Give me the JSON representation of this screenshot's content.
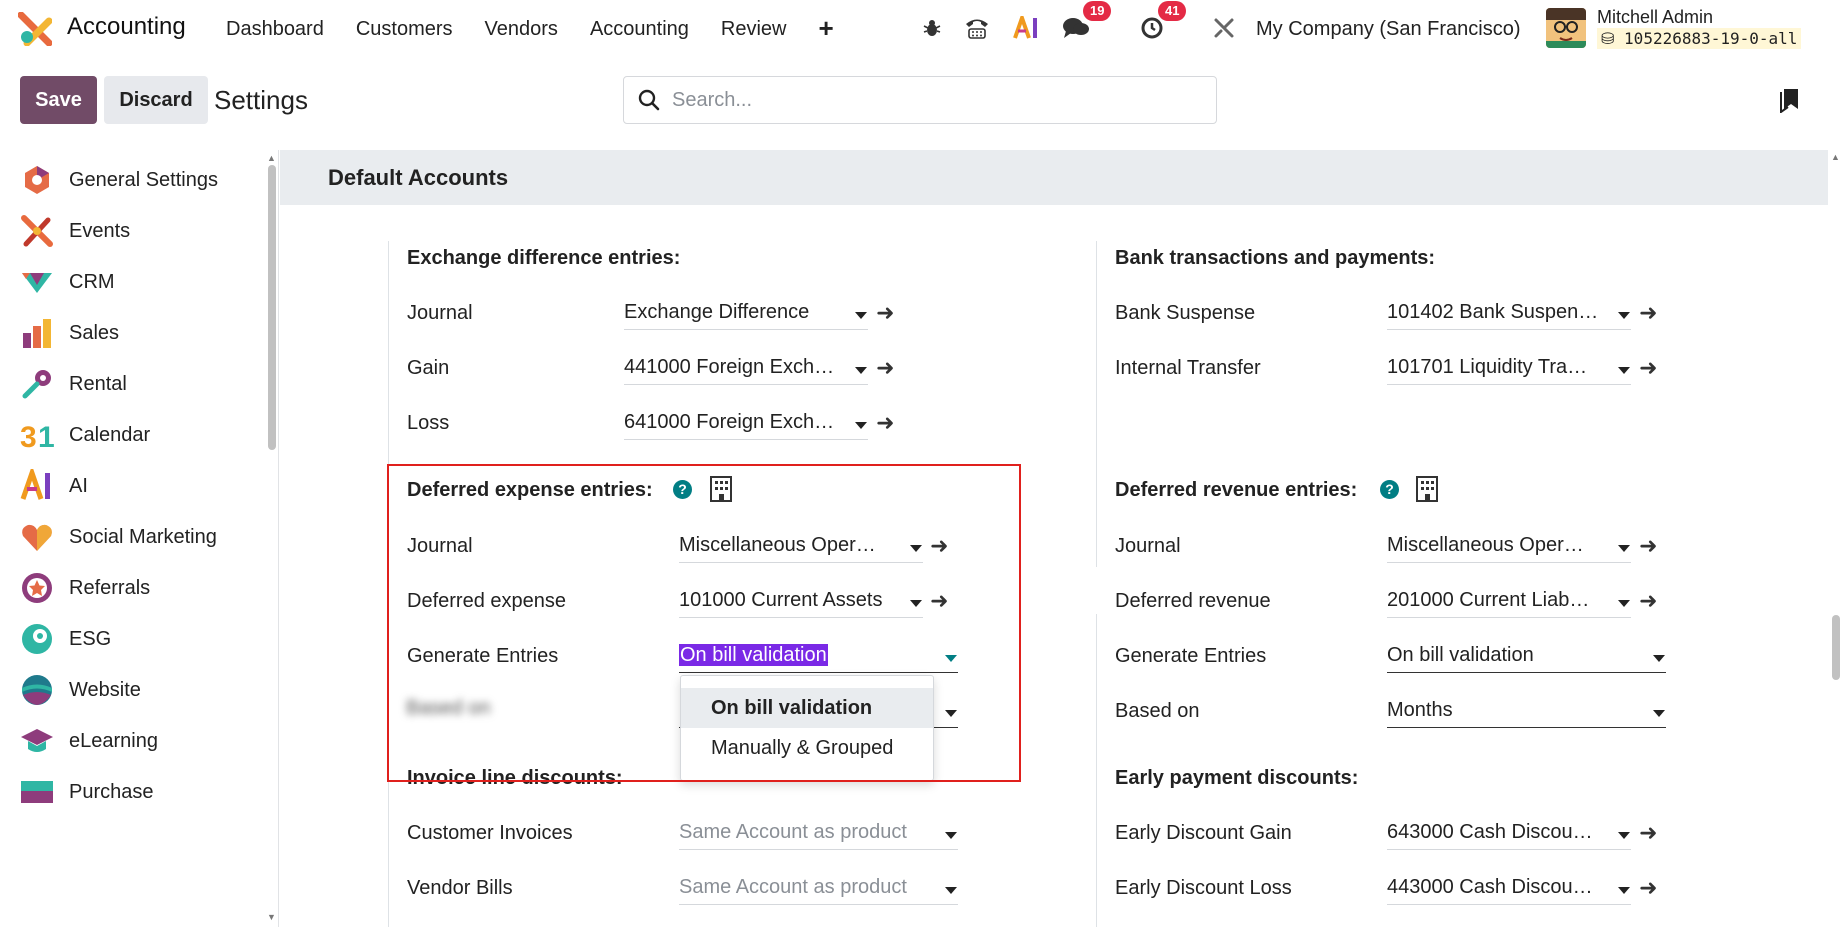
{
  "nav": {
    "app_name": "Accounting",
    "menu": [
      "Dashboard",
      "Customers",
      "Vendors",
      "Accounting",
      "Review"
    ],
    "plus": "+",
    "chat_badge": "19",
    "activity_badge": "41",
    "company": "My Company (San Francisco)",
    "user_name": "Mitchell Admin",
    "db_name": "105226883-19-0-all"
  },
  "control": {
    "save_label": "Save",
    "discard_label": "Discard",
    "title": "Settings",
    "search_placeholder": "Search..."
  },
  "sidebar": {
    "items": [
      {
        "label": "General Settings",
        "icon": "general-settings-icon"
      },
      {
        "label": "Events",
        "icon": "events-icon"
      },
      {
        "label": "CRM",
        "icon": "crm-icon"
      },
      {
        "label": "Sales",
        "icon": "sales-icon"
      },
      {
        "label": "Rental",
        "icon": "rental-icon"
      },
      {
        "label": "Calendar",
        "icon": "calendar-icon"
      },
      {
        "label": "AI",
        "icon": "ai-icon"
      },
      {
        "label": "Social Marketing",
        "icon": "social-marketing-icon"
      },
      {
        "label": "Referrals",
        "icon": "referrals-icon"
      },
      {
        "label": "ESG",
        "icon": "esg-icon"
      },
      {
        "label": "Website",
        "icon": "website-icon"
      },
      {
        "label": "eLearning",
        "icon": "elearning-icon"
      },
      {
        "label": "Purchase",
        "icon": "purchase-icon"
      }
    ]
  },
  "content": {
    "section_title": "Default Accounts",
    "exchange": {
      "title": "Exchange difference entries:",
      "journal_label": "Journal",
      "journal_value": "Exchange Difference",
      "gain_label": "Gain",
      "gain_value": "441000 Foreign Exch…",
      "loss_label": "Loss",
      "loss_value": "641000 Foreign Exch…"
    },
    "bank": {
      "title": "Bank transactions and payments:",
      "suspense_label": "Bank Suspense",
      "suspense_value": "101402 Bank Suspen…",
      "transfer_label": "Internal Transfer",
      "transfer_value": "101701 Liquidity Tra…"
    },
    "deferred_expense": {
      "title": "Deferred expense entries:",
      "journal_label": "Journal",
      "journal_value": "Miscellaneous Oper…",
      "account_label": "Deferred expense",
      "account_value": "101000 Current Assets",
      "generate_label": "Generate Entries",
      "generate_value": "On bill validation",
      "based_on_label": "Based on",
      "options": [
        "On bill validation",
        "Manually & Grouped"
      ]
    },
    "deferred_revenue": {
      "title": "Deferred revenue entries:",
      "journal_label": "Journal",
      "journal_value": "Miscellaneous Oper…",
      "account_label": "Deferred revenue",
      "account_value": "201000 Current Liab…",
      "generate_label": "Generate Entries",
      "generate_value": "On bill validation",
      "based_on_label": "Based on",
      "based_on_value": "Months"
    },
    "invoice_discounts": {
      "title": "Invoice line discounts:",
      "customer_label": "Customer Invoices",
      "customer_placeholder": "Same Account as product",
      "vendor_label": "Vendor Bills",
      "vendor_placeholder": "Same Account as product"
    },
    "early_discounts": {
      "title": "Early payment discounts:",
      "gain_label": "Early Discount Gain",
      "gain_value": "643000 Cash Discou…",
      "loss_label": "Early Discount Loss",
      "loss_value": "443000 Cash Discou…"
    }
  },
  "colors": {
    "brand": "#714b67",
    "badge": "#e42a45",
    "help": "#017e84",
    "highlight": "#7a29e6",
    "annotation": "#e0201d"
  }
}
